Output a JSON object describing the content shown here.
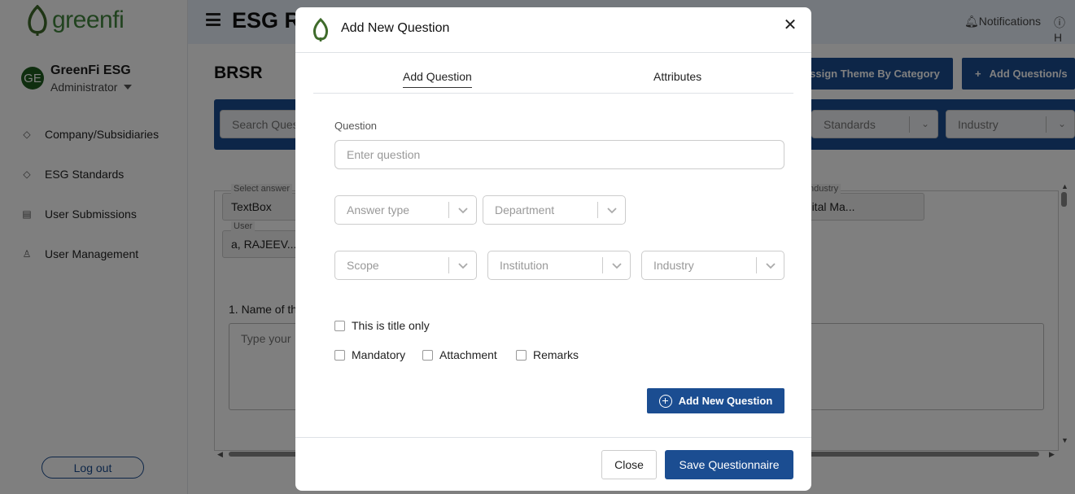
{
  "sidebar": {
    "logo_text": "greenfi",
    "user_name": "GreenFi ESG",
    "user_role": "Administrator",
    "avatar_initials": "GE",
    "nav": [
      {
        "label": "Company/Subsidiaries",
        "icon": "diamond-icon"
      },
      {
        "label": "ESG Standards",
        "icon": "diamond-icon"
      },
      {
        "label": "User Submissions",
        "icon": "document-icon"
      },
      {
        "label": "User Management",
        "icon": "person-icon"
      }
    ],
    "logout": "Log out"
  },
  "topbar": {
    "title": "ESG R",
    "notifications": "Notifications",
    "help": "H"
  },
  "page": {
    "title": "BRSR",
    "assign_theme": "ssign Theme By Category",
    "add_question": "Add Question/s",
    "search_placeholder": "Search Ques",
    "filter_standards": "Standards",
    "filter_industry": "Industry",
    "answer_label": "Select answer",
    "answer_value": "TextBox",
    "user_label": "User",
    "user_value": "a, RAJEEV...",
    "industry_label": "ndustry",
    "industry_value": "apital Ma...",
    "question_label": "1. Name of th",
    "question_placeholder": "Type your"
  },
  "modal": {
    "title": "Add New Question",
    "tabs": [
      "Add Question",
      "Attributes"
    ],
    "question_caption": "Question",
    "question_placeholder": "Enter question",
    "selects": {
      "answer_type": "Answer type",
      "department": "Department",
      "scope": "Scope",
      "institution": "Institution",
      "industry": "Industry"
    },
    "checks": {
      "title_only": "This is title only",
      "mandatory": "Mandatory",
      "attachment": "Attachment",
      "remarks": "Remarks"
    },
    "add_button": "Add New Question",
    "close_button": "Close",
    "save_button": "Save Questionnaire"
  },
  "colors": {
    "brand_blue": "#1b4d91",
    "brand_green": "#43873f",
    "overlay": "rgba(0,0,0,0.5)"
  }
}
